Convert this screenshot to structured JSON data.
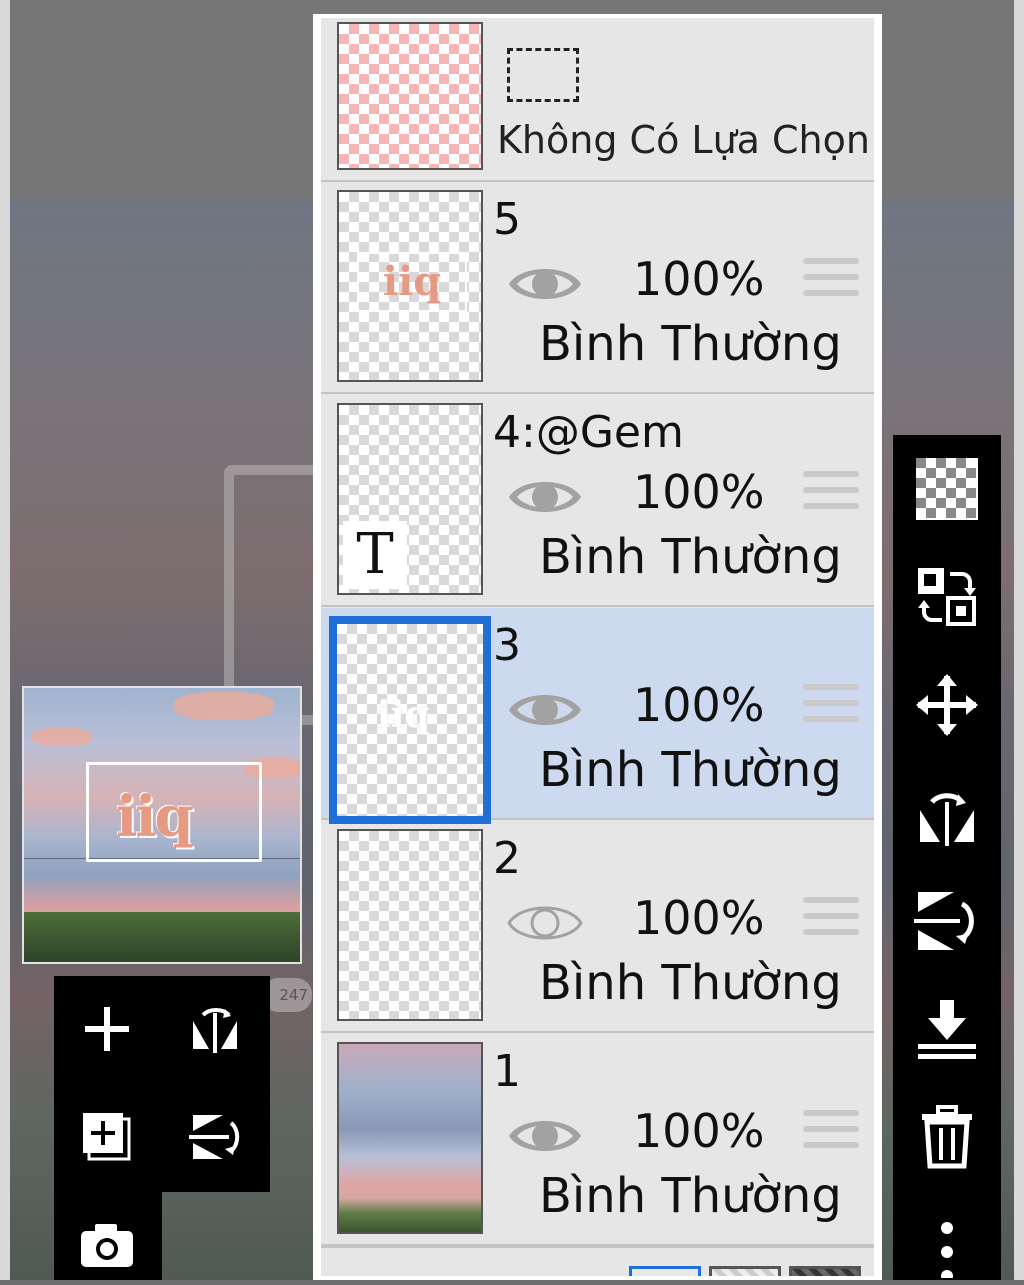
{
  "selection_row": {
    "label": "Không Có Lựa Chọn"
  },
  "layers": [
    {
      "name": "5",
      "opacity": "100%",
      "blend": "Bình Thường",
      "visible": true,
      "selected": false
    },
    {
      "name": "4:@Gem",
      "opacity": "100%",
      "blend": "Bình Thường",
      "visible": true,
      "selected": false
    },
    {
      "name": "3",
      "opacity": "100%",
      "blend": "Bình Thường",
      "visible": true,
      "selected": true
    },
    {
      "name": "2",
      "opacity": "100%",
      "blend": "Bình Thường",
      "visible": false,
      "selected": false
    },
    {
      "name": "1",
      "opacity": "100%",
      "blend": "Bình Thường",
      "visible": true,
      "selected": false
    }
  ],
  "canvas": {
    "counter_text": "247"
  },
  "preview": {
    "logo_text": "iiq"
  },
  "icons": {
    "left_tools": [
      "plus-icon",
      "flip-horizontal-icon",
      "add-layer-icon",
      "flip-vertical-icon",
      "camera-icon"
    ],
    "right_tools": [
      "transparency-icon",
      "swap-layers-icon",
      "move-icon",
      "rotate-flip-horizontal-icon",
      "rotate-flip-vertical-icon",
      "merge-down-icon",
      "trash-icon",
      "more-icon"
    ]
  },
  "colors": {
    "selection_accent": "#1f6fd6",
    "selected_row_bg": "#ccd9ee",
    "panel_bg": "#e6e6e6",
    "toolbar_bg": "#000000"
  }
}
